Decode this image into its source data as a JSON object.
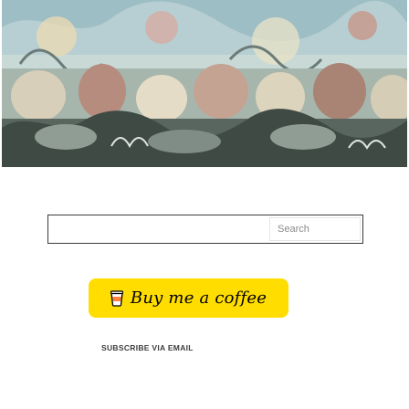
{
  "search": {
    "placeholder": "Search"
  },
  "coffee_button": {
    "label": "Buy me a coffee"
  },
  "subscribe": {
    "heading": "SUBSCRIBE VIA EMAIL"
  },
  "colors": {
    "coffee_button_bg": "#ffdd00",
    "search_border": "#3a3a3a",
    "heading_text": "#3d3d3d"
  },
  "icons": {
    "coffee_icon": "coffee-cup-icon"
  }
}
